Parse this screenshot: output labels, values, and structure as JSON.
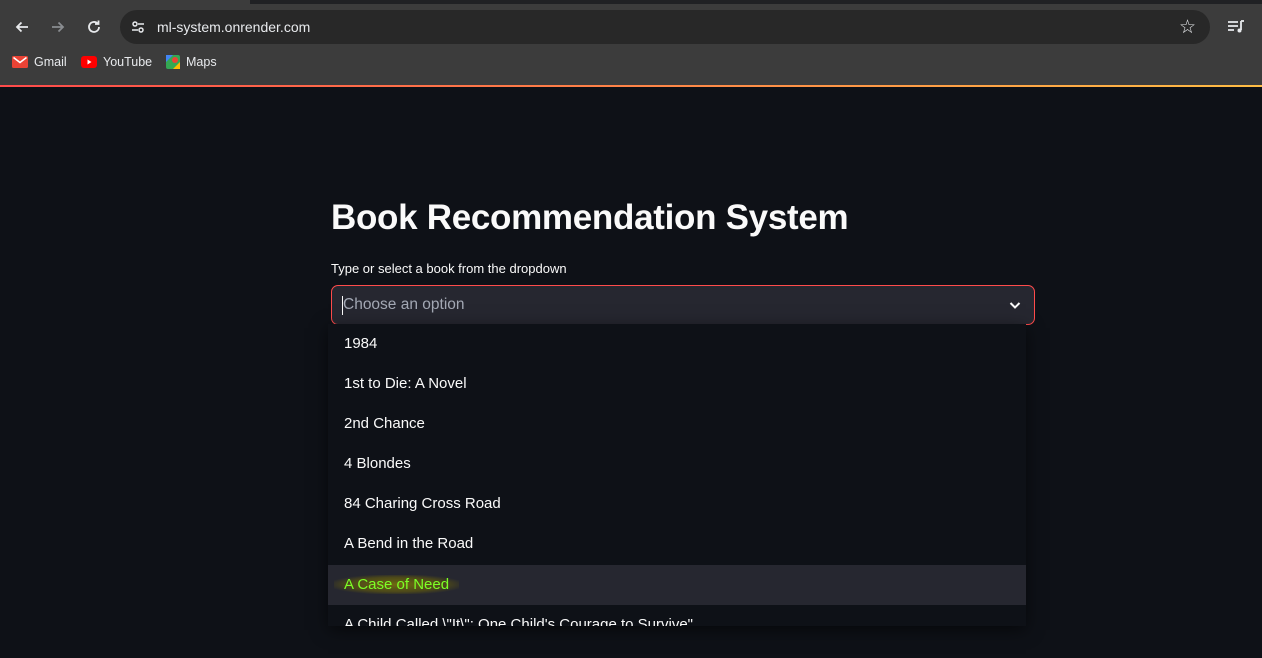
{
  "browser": {
    "url": "ml-system.onrender.com",
    "bookmarks": [
      {
        "label": "Gmail",
        "icon": "gmail-icon"
      },
      {
        "label": "YouTube",
        "icon": "youtube-icon"
      },
      {
        "label": "Maps",
        "icon": "maps-icon"
      }
    ]
  },
  "app": {
    "title": "Book Recommendation System",
    "select_label": "Type or select a book from the dropdown",
    "select_placeholder": "Choose an option",
    "options": [
      "1984",
      "1st to Die: A Novel",
      "2nd Chance",
      "4 Blondes",
      "84 Charing Cross Road",
      "A Bend in the Road",
      "A Case of Need",
      "A Child Called \\\"It\\\": One Child's Courage to Survive\""
    ],
    "highlighted_option": "A Case of Need"
  },
  "colors": {
    "background": "#0e1117",
    "accent": "#ff4b4b",
    "input_background": "#262730",
    "highlight_text": "#7cff26"
  }
}
